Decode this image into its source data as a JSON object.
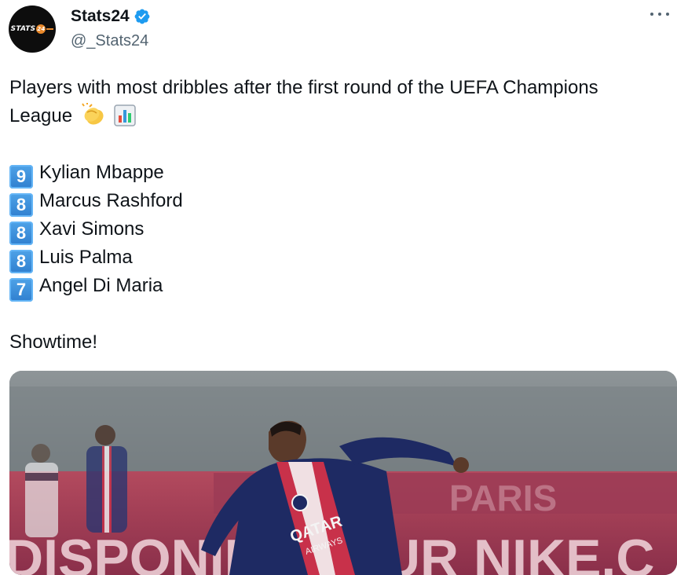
{
  "author": {
    "display_name": "Stats24",
    "handle": "@_Stats24",
    "verified": true,
    "avatar_text": "STATS",
    "avatar_badge": "24"
  },
  "tweet": {
    "intro": "Players with most dribbles after the first round of the UEFA Champions",
    "intro_cont": "League",
    "intro_emojis": [
      "clapping-hands-emoji",
      "bar-chart-emoji"
    ],
    "players": [
      {
        "rank_key": "9",
        "name": "Kylian Mbappe"
      },
      {
        "rank_key": "8",
        "name": "Marcus Rashford"
      },
      {
        "rank_key": "8",
        "name": "Xavi Simons"
      },
      {
        "rank_key": "8",
        "name": "Luis Palma"
      },
      {
        "rank_key": "7",
        "name": "Angel Di Maria"
      }
    ],
    "closing": "Showtime!"
  },
  "media": {
    "shirt_sponsor": "QATAR",
    "shirt_sponsor_sub": "AIRWAYS",
    "board_text_lower": "DISPONIBLE SUR NIKE.C",
    "board_text_upper": "PARIS"
  },
  "colors": {
    "text": "#0f1419",
    "secondary": "#536471",
    "verified_blue": "#1d9bf0",
    "keycap_blue": "#2f7fcf"
  }
}
